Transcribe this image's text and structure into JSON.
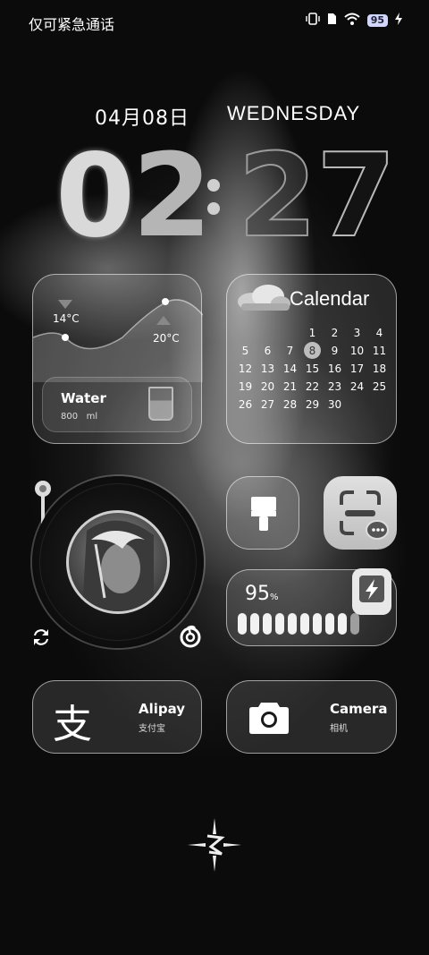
{
  "status_bar": {
    "carrier": "仅可紧急通话",
    "battery_level": "95"
  },
  "lock_date": {
    "date": "04月08日",
    "weekday": "WEDNESDAY"
  },
  "clock": {
    "h1": "0",
    "h2": "2",
    "m1": "2",
    "m2": "7"
  },
  "weather": {
    "low": "14°C",
    "high": "20°C"
  },
  "water": {
    "title": "Water",
    "value": "800",
    "unit": "ml"
  },
  "calendar": {
    "title": "Calendar",
    "weeks": [
      [
        "",
        "",
        "",
        "1",
        "2",
        "3",
        "4"
      ],
      [
        "5",
        "6",
        "7",
        "8",
        "9",
        "10",
        "11"
      ],
      [
        "12",
        "13",
        "14",
        "15",
        "16",
        "17",
        "18"
      ],
      [
        "19",
        "20",
        "21",
        "22",
        "23",
        "24",
        "25"
      ],
      [
        "26",
        "27",
        "28",
        "29",
        "30",
        "",
        ""
      ]
    ],
    "today": "8"
  },
  "battery_widget": {
    "percent": "95",
    "unit": "%",
    "level": 0.9
  },
  "apps": {
    "alipay_name": "Alipay",
    "alipay_sub": "支付宝",
    "alipay_glyph": "支",
    "camera_name": "Camera",
    "camera_sub": "相机"
  },
  "icons": {
    "status": [
      "vibrate-icon",
      "sim-icon",
      "wifi-icon",
      "battery-icon",
      "charging-icon"
    ],
    "widgets": [
      "cloud-icon",
      "cup-icon",
      "brush-icon",
      "scan-icon",
      "bolt-icon",
      "refresh-icon",
      "netease-music-icon",
      "camera-icon",
      "alipay-icon",
      "emblem-icon"
    ]
  }
}
